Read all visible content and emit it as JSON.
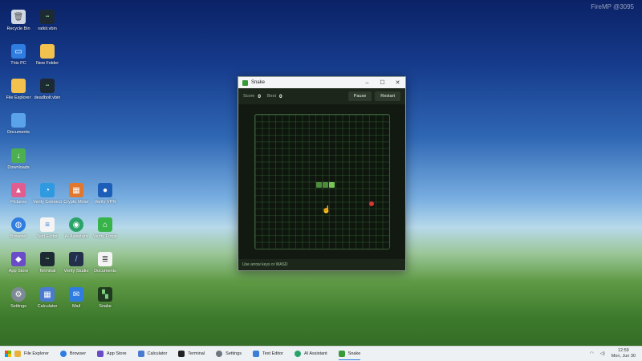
{
  "watermark": "FireMP @3095",
  "desktop_icons": [
    {
      "label": "Recycle Bin",
      "icon": "recycle-bin-icon"
    },
    {
      "label": "ratkit.vbin",
      "icon": "terminal-icon"
    },
    {
      "label": "This PC",
      "icon": "pc-icon"
    },
    {
      "label": "New Folder",
      "icon": "folder-icon"
    },
    {
      "label": "File Explorer",
      "icon": "folder-icon"
    },
    {
      "label": "deadbolt.vbin",
      "icon": "terminal-icon"
    },
    {
      "label": "Documents",
      "icon": "folder-icon"
    },
    {
      "label": "Downloads",
      "icon": "download-folder-icon"
    },
    {
      "label": "Pictures",
      "icon": "pictures-icon"
    },
    {
      "label": "Verity Connect",
      "icon": "chat-icon"
    },
    {
      "label": "Crypto Miner",
      "icon": "miner-icon"
    },
    {
      "label": "Verity VPN",
      "icon": "vpn-icon"
    },
    {
      "label": "Browser",
      "icon": "globe-icon"
    },
    {
      "label": "Text Editor",
      "icon": "text-editor-icon"
    },
    {
      "label": "AI Assistant",
      "icon": "ai-assistant-icon"
    },
    {
      "label": "Verity Forge",
      "icon": "forge-icon"
    },
    {
      "label": "App Store",
      "icon": "app-store-icon"
    },
    {
      "label": "Terminal",
      "icon": "terminal-icon"
    },
    {
      "label": "Verity Studio",
      "icon": "studio-icon"
    },
    {
      "label": "Documents",
      "icon": "documents-icon"
    },
    {
      "label": "Settings",
      "icon": "gear-icon"
    },
    {
      "label": "Calculator",
      "icon": "calculator-icon"
    },
    {
      "label": "Mail",
      "icon": "mail-icon"
    },
    {
      "label": "Snake",
      "icon": "snake-icon"
    }
  ],
  "window": {
    "title": "Snake",
    "score_label": "Score",
    "score_value": "0",
    "best_label": "Best",
    "best_value": "0",
    "pause_label": "Pause",
    "restart_label": "Restart",
    "hint": "Use arrow keys or WASD"
  },
  "taskbar": {
    "items": [
      {
        "label": "File Explorer",
        "color": "#e8b23a"
      },
      {
        "label": "Browser",
        "color": "#2f7de0"
      },
      {
        "label": "App Store",
        "color": "#6a4cc9"
      },
      {
        "label": "Calculator",
        "color": "#4a7bd0"
      },
      {
        "label": "Terminal",
        "color": "#222222"
      },
      {
        "label": "Settings",
        "color": "#6d7780"
      },
      {
        "label": "Text Editor",
        "color": "#3c7fd9"
      },
      {
        "label": "AI Assistant",
        "color": "#2aa36a"
      },
      {
        "label": "Snake",
        "color": "#3a9a3a"
      }
    ],
    "time": "12:59",
    "date": "Mon, Jun 30"
  }
}
